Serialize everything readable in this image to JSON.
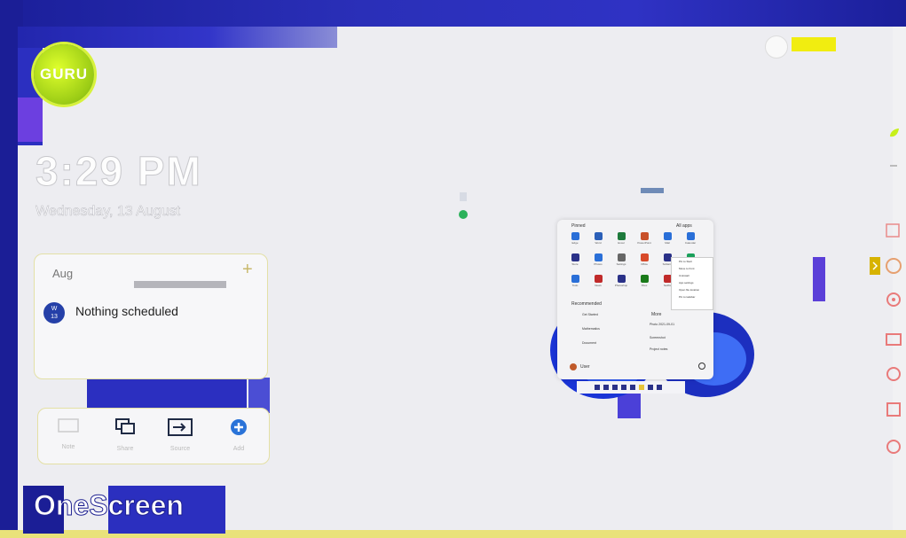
{
  "brand": {
    "logo_text": "GURU",
    "footer_brand": "OneScreen"
  },
  "clock": {
    "time": "3:29 PM",
    "date": "Wednesday, 13 August"
  },
  "calendar": {
    "month": "Aug",
    "add_symbol": "+",
    "day_badge_top": "W",
    "day_badge_num": "13",
    "empty_message": "Nothing scheduled"
  },
  "dock": {
    "items": [
      {
        "icon": "whiteboard-icon",
        "label": "Note"
      },
      {
        "icon": "screen-share-icon",
        "label": "Share"
      },
      {
        "icon": "input-source-icon",
        "label": "Source"
      },
      {
        "icon": "plus-circle-icon",
        "label": "Add"
      }
    ]
  },
  "start_menu": {
    "pinned_title": "Pinned",
    "all_apps": "All apps",
    "recommended_title": "Recommended",
    "more": "More",
    "user_name": "User",
    "pinned_apps": [
      "Edge",
      "Word",
      "Excel",
      "PowerPoint",
      "Mail",
      "Calendar",
      "Store",
      "Photos",
      "Settings",
      "Office",
      "Solitaire",
      "Spotify",
      "Todo",
      "News",
      "Photoshop",
      "Xbox",
      "Netflix",
      "Clipchamp"
    ],
    "context_menu": [
      "Pin to Start",
      "Move to front",
      "Uninstall",
      "App settings",
      "Open file location",
      "Pin to taskbar"
    ],
    "recommended": [
      "Get Started",
      "Photo 2021-09-01",
      "Mathematics",
      "Screenshot",
      "Document",
      "Project notes"
    ]
  },
  "colors": {
    "bezel": "#1b1e96",
    "accent_blue": "#2b2fc0",
    "lime": "#c7f01a",
    "yellow": "#f1ed10"
  }
}
